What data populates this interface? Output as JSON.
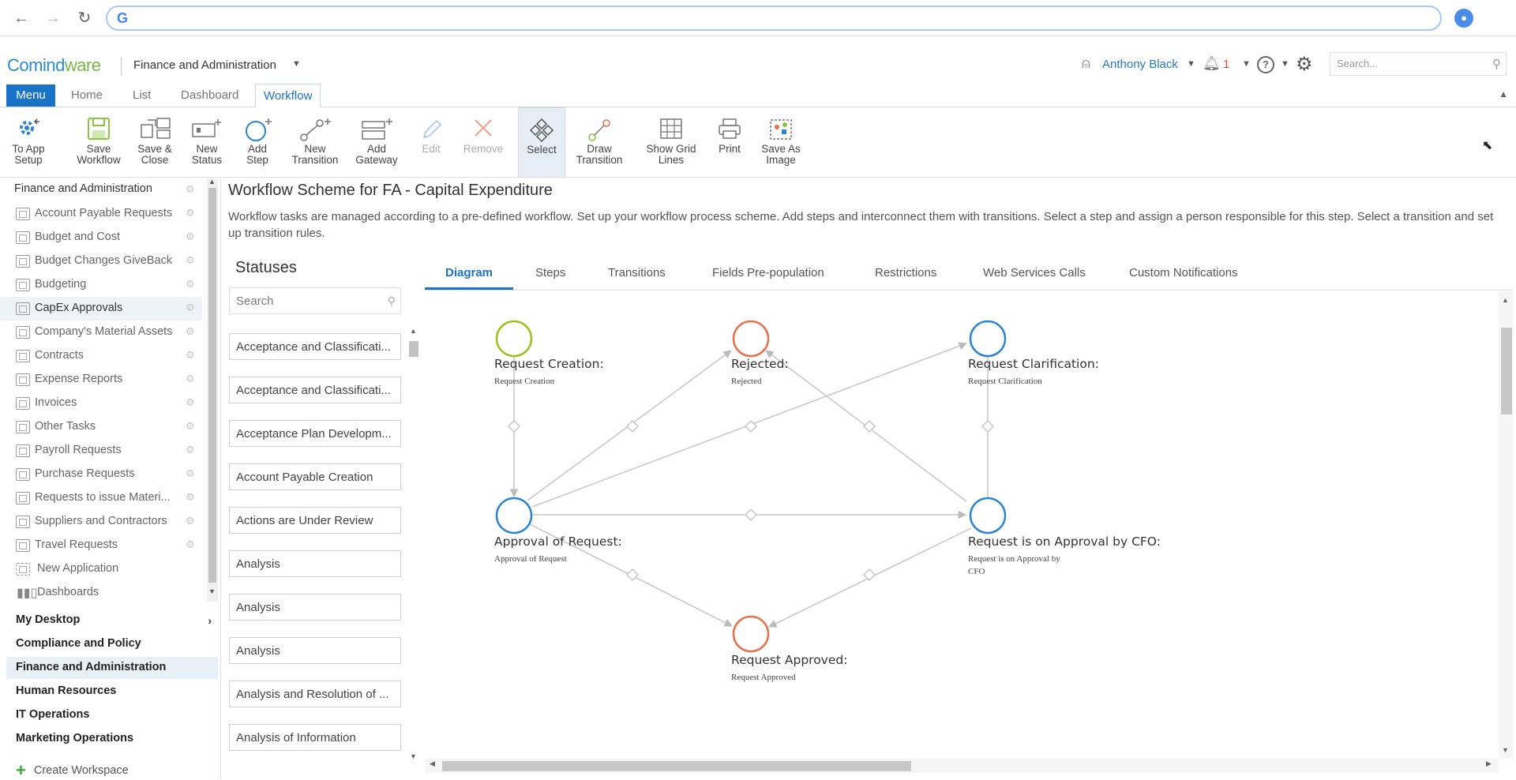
{
  "browser": {
    "back": "←",
    "forward": "→",
    "reload": "↻",
    "address_value": ""
  },
  "header": {
    "logo_main": "Comind",
    "logo_accent": "ware",
    "app_title": "Finance and Administration",
    "user_name": "Anthony Black",
    "notifications_count": "1",
    "search_placeholder": "Search..."
  },
  "tabs": [
    {
      "label": "Menu"
    },
    {
      "label": "Home"
    },
    {
      "label": "List"
    },
    {
      "label": "Dashboard"
    },
    {
      "label": "Workflow"
    }
  ],
  "toolbar": {
    "to_app_setup": [
      "To App",
      "Setup"
    ],
    "save_workflow": [
      "Save",
      "Workflow"
    ],
    "save_close": [
      "Save &",
      "Close"
    ],
    "new_status": [
      "New",
      "Status"
    ],
    "add_step": [
      "Add",
      "Step"
    ],
    "new_transition": [
      "New",
      "Transition"
    ],
    "add_gateway": [
      "Add",
      "Gateway"
    ],
    "edit": [
      "Edit"
    ],
    "remove": [
      "Remove"
    ],
    "select": [
      "Select"
    ],
    "draw_transition": [
      "Draw",
      "Transition"
    ],
    "show_grid_lines": [
      "Show Grid",
      "Lines"
    ],
    "print": [
      "Print"
    ],
    "save_as_image": [
      "Save As",
      "Image"
    ]
  },
  "sidebar": {
    "group_title": "Finance and Administration",
    "items": [
      {
        "label": "Account Payable Requests"
      },
      {
        "label": "Budget and Cost"
      },
      {
        "label": "Budget Changes GiveBack"
      },
      {
        "label": "Budgeting"
      },
      {
        "label": "CapEx Approvals"
      },
      {
        "label": "Company's Material Assets"
      },
      {
        "label": "Contracts"
      },
      {
        "label": "Expense Reports"
      },
      {
        "label": "Invoices"
      },
      {
        "label": "Other Tasks"
      },
      {
        "label": "Payroll Requests"
      },
      {
        "label": "Purchase Requests"
      },
      {
        "label": "Requests to issue Materi..."
      },
      {
        "label": "Suppliers and Contractors"
      },
      {
        "label": "Travel Requests"
      }
    ],
    "new_application": "New Application",
    "dashboards": "Dashboards",
    "workspaces": [
      {
        "label": "My Desktop"
      },
      {
        "label": "Compliance and Policy"
      },
      {
        "label": "Finance and Administration"
      },
      {
        "label": "Human Resources"
      },
      {
        "label": "IT Operations"
      },
      {
        "label": "Marketing Operations"
      }
    ],
    "create_workspace": "Create Workspace"
  },
  "main": {
    "title": "Workflow Scheme for FA - Capital Expenditure",
    "description": "Workflow tasks are managed according to a pre-defined workflow. Set up your workflow process scheme. Add steps and interconnect them with transitions. Select a step and assign a person responsible for this step. Select a transition and set up transition rules.",
    "statuses_title": "Statuses",
    "status_search_placeholder": "Search",
    "statuses": [
      "Acceptance and Classificati...",
      "Acceptance and Classificati...",
      "Acceptance Plan Developm...",
      "Account Payable Creation",
      "Actions are Under Review",
      "Analysis",
      "Analysis",
      "Analysis",
      "Analysis and Resolution of ...",
      "Analysis of Information"
    ],
    "diagram_tabs": [
      {
        "label": "Diagram"
      },
      {
        "label": "Steps"
      },
      {
        "label": "Transitions"
      },
      {
        "label": "Fields Pre-population"
      },
      {
        "label": "Restrictions"
      },
      {
        "label": "Web Services Calls"
      },
      {
        "label": "Custom Notifications"
      }
    ]
  },
  "diagram": {
    "nodes": [
      {
        "title": "Request Creation:",
        "sub": "Request Creation",
        "color": "#9ac31c"
      },
      {
        "title": "Rejected:",
        "sub": "Rejected",
        "color": "#e8704a"
      },
      {
        "title": "Request Clarification:",
        "sub": "Request Clarification",
        "color": "#2a85d4"
      },
      {
        "title": "Approval of Request:",
        "sub": "Approval of Request",
        "color": "#2a85d4"
      },
      {
        "title": "Request is on Approval by CFO:",
        "sub": "Request is on Approval by CFO",
        "color": "#2a85d4"
      },
      {
        "title": "Request Approved:",
        "sub": "Request Approved",
        "color": "#e8704a"
      }
    ]
  },
  "colors": {
    "accent": "#1a73c6",
    "green": "#9ac31c",
    "orange": "#e8704a",
    "blue": "#2a85d4"
  }
}
